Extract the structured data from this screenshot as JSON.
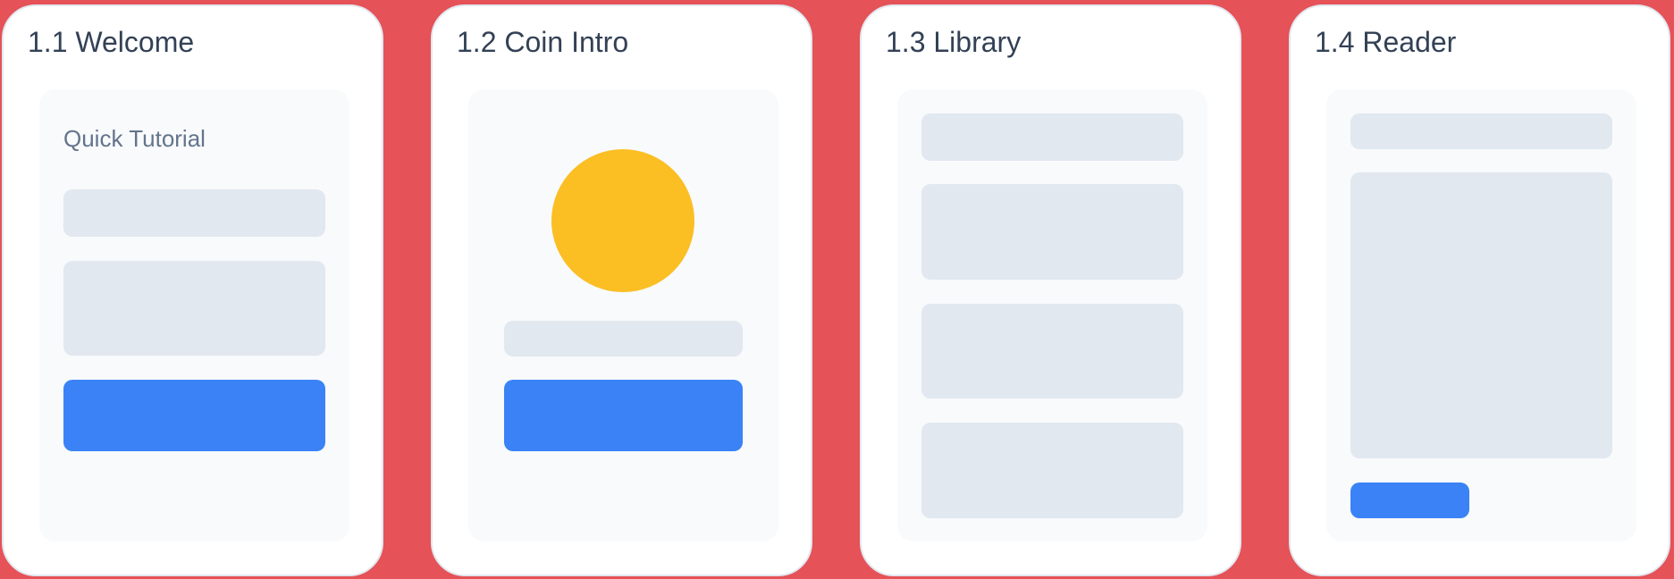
{
  "screens": [
    {
      "title": "1.1 Welcome"
    },
    {
      "title": "1.2 Coin Intro"
    },
    {
      "title": "1.3 Library"
    },
    {
      "title": "1.4 Reader"
    }
  ],
  "welcome": {
    "heading": "Quick Tutorial"
  },
  "colors": {
    "background": "#e55257",
    "card": "#ffffff",
    "panel": "#f8fafc",
    "placeholder": "#e2e8f0",
    "primary_button": "#3b82f6",
    "coin": "#fbbf24",
    "title_text": "#334155",
    "muted_text": "#64748b"
  }
}
